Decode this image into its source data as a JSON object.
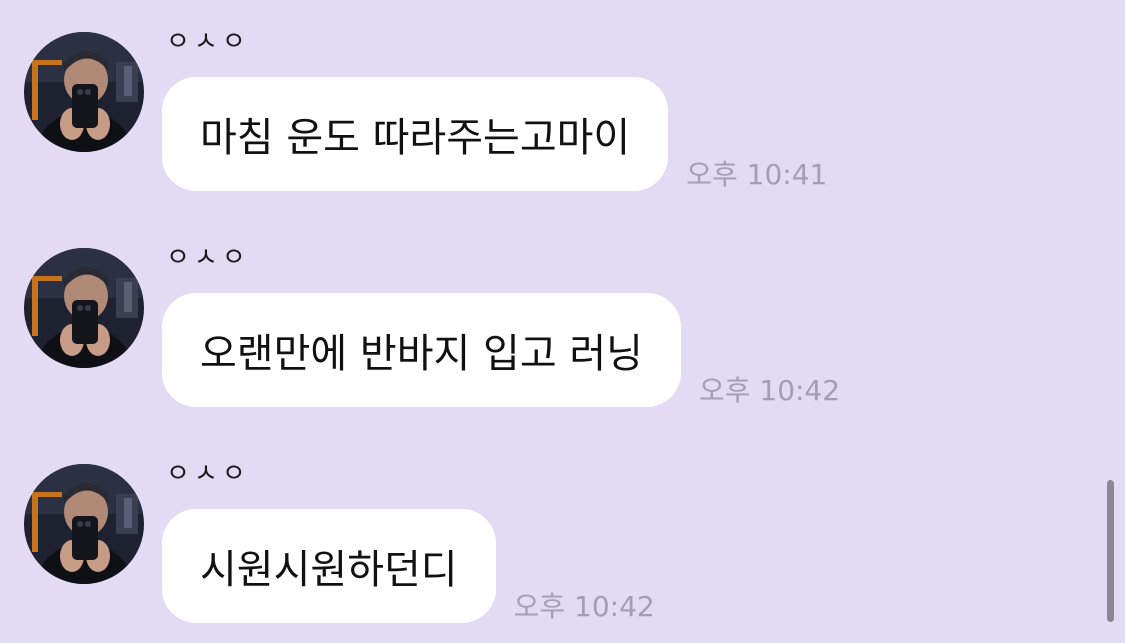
{
  "messages": [
    {
      "sender": "ㅇㅅㅇ",
      "text": "마침 운도 따라주는고마이",
      "time": "오후 10:41"
    },
    {
      "sender": "ㅇㅅㅇ",
      "text": "오랜만에 반바지 입고 러닝",
      "time": "오후 10:42"
    },
    {
      "sender": "ㅇㅅㅇ",
      "text": "시원시원하던디",
      "time": "오후 10:42"
    }
  ],
  "colors": {
    "background": "#e3daf3",
    "bubble": "#ffffff",
    "time": "#a59db3",
    "scrollbar": "#8b8794"
  },
  "icons": {
    "avatar": "profile-photo-avatar"
  }
}
